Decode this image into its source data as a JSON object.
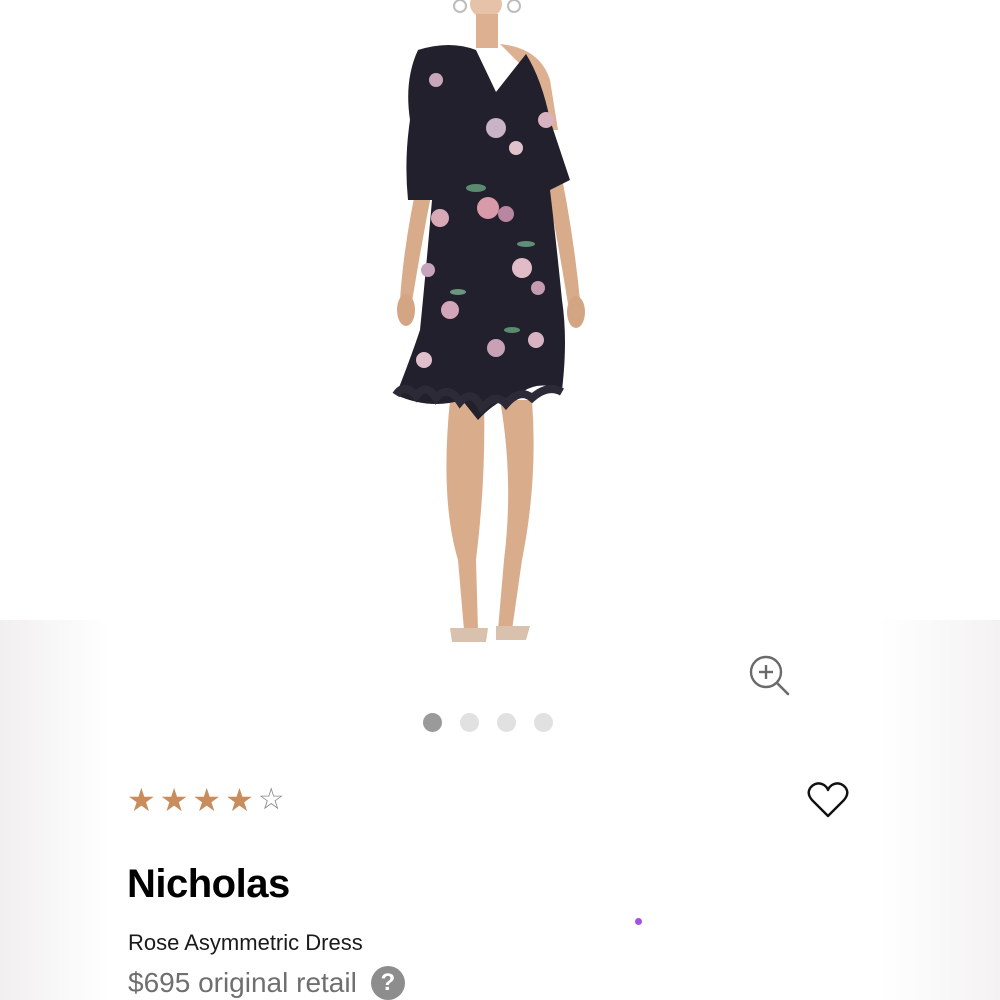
{
  "product": {
    "image_alt": "Rose Asymmetric Dress model photo",
    "brand": "Nicholas",
    "name": "Rose Asymmetric Dress",
    "price_text": "$695 original retail",
    "help_glyph": "?"
  },
  "rating": {
    "value": 4,
    "max": 5,
    "filled_glyph": "★",
    "empty_glyph": "☆"
  },
  "carousel": {
    "count": 4,
    "active_index": 0
  },
  "icons": {
    "zoom": "zoom-in-icon",
    "favorite": "heart-outline-icon",
    "help": "question-circle-icon"
  },
  "colors": {
    "star": "#c98c5c",
    "dot_active": "#9a9a9a",
    "dot_inactive": "#e1e1e1",
    "price": "#6f6f6f",
    "accent_dot": "#a451e0"
  }
}
